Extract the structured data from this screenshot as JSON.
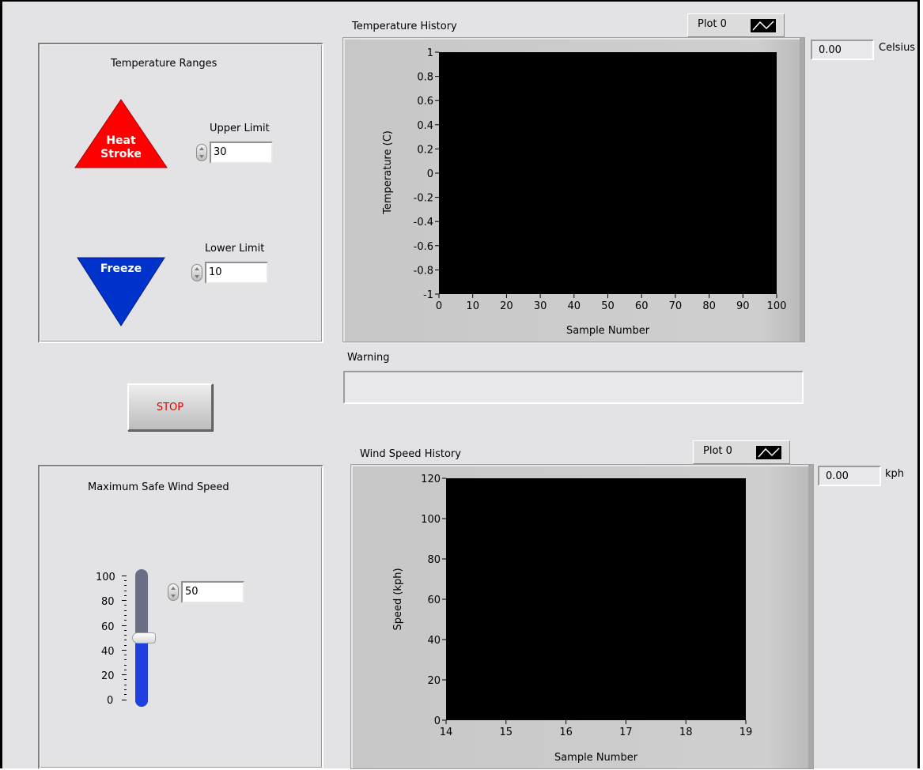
{
  "temperature_ranges": {
    "title": "Temperature Ranges",
    "heat_label_1": "Heat",
    "heat_label_2": "Stroke",
    "freeze_label": "Freeze",
    "upper_limit_label": "Upper Limit",
    "upper_limit_value": "30",
    "lower_limit_label": "Lower Limit",
    "lower_limit_value": "10",
    "heat_color": "#ff0000",
    "freeze_color": "#0033cc"
  },
  "stop_button": {
    "label": "STOP",
    "color": "#e00000"
  },
  "wind_panel": {
    "title": "Maximum Safe Wind Speed",
    "slider_ticks": [
      "100",
      "80",
      "60",
      "40",
      "20",
      "0"
    ],
    "slider_value": 50,
    "slider_max": 100,
    "numeric_value": "50",
    "fill_color": "#1f3fe0"
  },
  "temp_chart": {
    "title": "Temperature History",
    "legend_label": "Plot 0",
    "readout_value": "0.00",
    "readout_unit": "Celsius",
    "chart_data": {
      "type": "line",
      "title": "Temperature History",
      "xlabel": "Sample Number",
      "ylabel": "Temperature (C)",
      "xlim": [
        0,
        100
      ],
      "ylim": [
        -1,
        1
      ],
      "x_ticks": [
        "0",
        "10",
        "20",
        "30",
        "40",
        "50",
        "60",
        "70",
        "80",
        "90",
        "100"
      ],
      "y_ticks": [
        "1",
        "0.8",
        "0.6",
        "0.4",
        "0.2",
        "0",
        "-0.2",
        "-0.4",
        "-0.6",
        "-0.8",
        "-1"
      ],
      "series": [
        {
          "name": "Plot 0",
          "values": []
        }
      ],
      "grid": false,
      "legend": "top-right",
      "background": "#000000"
    }
  },
  "warning": {
    "label": "Warning",
    "value": ""
  },
  "wind_chart": {
    "title": "Wind Speed History",
    "legend_label": "Plot 0",
    "readout_value": "0.00",
    "readout_unit": "kph",
    "chart_data": {
      "type": "line",
      "title": "Wind Speed History",
      "xlabel": "Sample Number",
      "ylabel": "Speed (kph)",
      "xlim": [
        14,
        19
      ],
      "ylim": [
        0,
        120
      ],
      "x_ticks": [
        "14",
        "15",
        "16",
        "17",
        "18",
        "19"
      ],
      "y_ticks": [
        "120",
        "100",
        "80",
        "60",
        "40",
        "20",
        "0"
      ],
      "series": [
        {
          "name": "Plot 0",
          "values": []
        }
      ],
      "grid": false,
      "legend": "top-right",
      "background": "#000000"
    }
  }
}
